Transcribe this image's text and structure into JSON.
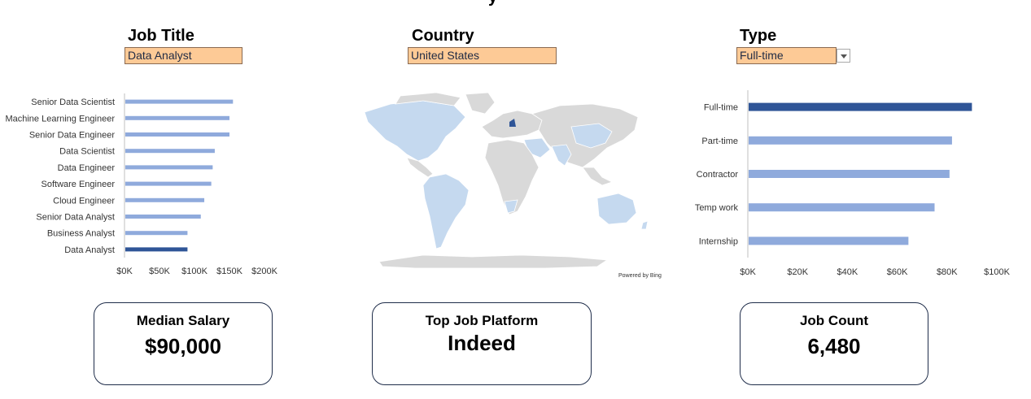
{
  "header": {
    "partial_title": "y"
  },
  "filters": {
    "job_title": {
      "label": "Job Title",
      "value": "Data Analyst"
    },
    "country": {
      "label": "Country",
      "value": "United States"
    },
    "type": {
      "label": "Type",
      "value": "Full-time"
    }
  },
  "map": {
    "credit": "Powered by Bing",
    "highlight_color": "#2f5597",
    "land_color": "#d9d9d9",
    "tint_color": "#c5d9ef"
  },
  "cards": {
    "median_salary": {
      "title": "Median Salary",
      "value": "$90,000"
    },
    "top_platform": {
      "title": "Top Job Platform",
      "value": "Indeed"
    },
    "job_count": {
      "title": "Job Count",
      "value": "6,480"
    }
  },
  "chart_data": [
    {
      "type": "bar",
      "orientation": "horizontal",
      "categories": [
        "Senior Data Scientist",
        "Machine Learning Engineer",
        "Senior Data Engineer",
        "Data Scientist",
        "Data Engineer",
        "Software Engineer",
        "Cloud Engineer",
        "Senior Data Analyst",
        "Business Analyst",
        "Data Analyst"
      ],
      "values": [
        155000,
        150000,
        150000,
        129000,
        126000,
        124000,
        114000,
        109000,
        90000,
        90000
      ],
      "highlight": "Data Analyst",
      "xlim": [
        0,
        200000
      ],
      "xticks": [
        "$0K",
        "$50K",
        "$100K",
        "$150K",
        "$200K"
      ],
      "bar_color": "#8faadc",
      "highlight_color": "#2f5597"
    },
    {
      "type": "bar",
      "orientation": "horizontal",
      "categories": [
        "Full-time",
        "Part-time",
        "Contractor",
        "Temp work",
        "Internship"
      ],
      "values": [
        90000,
        82000,
        81000,
        75000,
        64500
      ],
      "highlight": "Full-time",
      "xlim": [
        0,
        100000
      ],
      "xticks": [
        "$0K",
        "$20K",
        "$40K",
        "$60K",
        "$80K",
        "$100K"
      ],
      "bar_color": "#8faadc",
      "highlight_color": "#2f5597"
    }
  ]
}
